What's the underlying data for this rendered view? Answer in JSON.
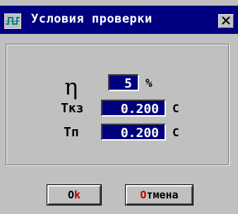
{
  "window": {
    "title": "Условия проверки",
    "icon": "signal-step-icon",
    "close_icon": "close-icon"
  },
  "fields": {
    "eta": {
      "label": "η",
      "value": "5",
      "unit": "%"
    },
    "tkz": {
      "label": "Tкз",
      "value": "0.200",
      "unit": "C"
    },
    "tp": {
      "label": "Tп",
      "value": "0.200",
      "unit": "C"
    }
  },
  "buttons": {
    "ok": {
      "hotkey": "O",
      "rest": "k"
    },
    "cancel": {
      "hotkey": "О",
      "rest": "тмена"
    }
  },
  "colors": {
    "titlebar": "#000080",
    "field_bg": "#000080",
    "field_text": "#ffffff",
    "face": "#c0c0c0",
    "hotkey": "#c00000"
  }
}
